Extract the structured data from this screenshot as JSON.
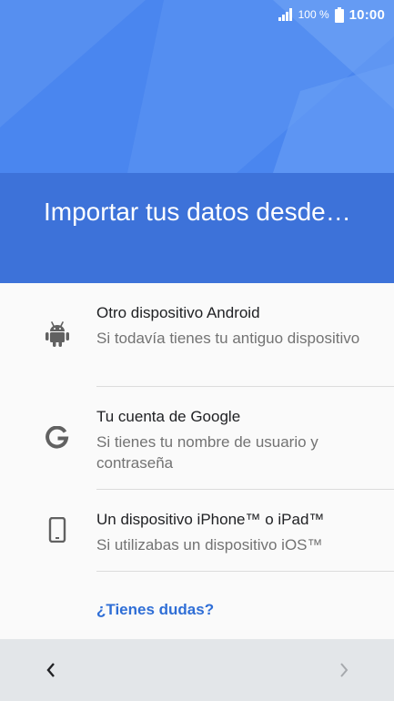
{
  "status": {
    "battery_pct": "100 %",
    "time": "10:00",
    "icons": [
      "signal-icon",
      "battery-icon"
    ]
  },
  "header": {
    "title": "Importar tus datos desde…"
  },
  "options": [
    {
      "icon": "android-icon",
      "title": "Otro dispositivo Android",
      "subtitle": "Si todavía tienes tu antiguo dispositivo"
    },
    {
      "icon": "google-g-icon",
      "title": "Tu cuenta de Google",
      "subtitle": "Si tienes tu nombre de usuario y contraseña"
    },
    {
      "icon": "phone-icon",
      "title": "Un dispositivo iPhone™ o iPad™",
      "subtitle": "Si utilizabas un dispositivo iOS™"
    }
  ],
  "help": {
    "label": "¿Tienes dudas?"
  },
  "navigation": {
    "back_icon": "chevron-left-icon",
    "next_icon": "chevron-right-icon"
  },
  "colors": {
    "hero_bg": "#4a86ef",
    "title_band": "#3d72d9",
    "link": "#2f6ed6",
    "icon": "#616161",
    "nav_bar": "#e3e6e9"
  }
}
